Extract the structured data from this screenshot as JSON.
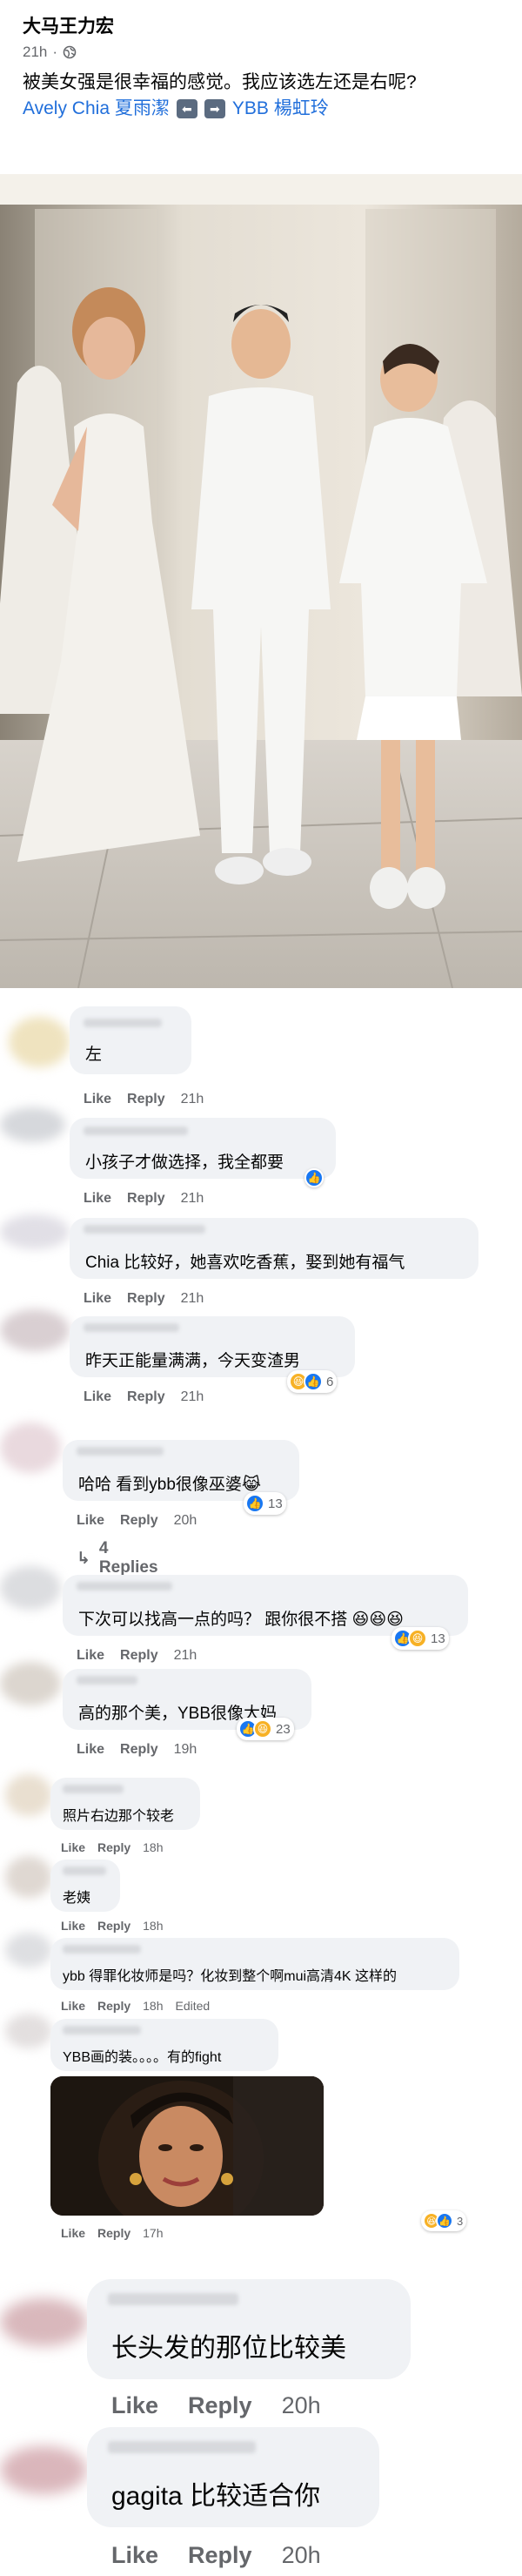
{
  "post": {
    "author": "大马王力宏",
    "time": "21h",
    "separator": "·",
    "text": "被美女强是很幸福的感觉。我应该选左还是右呢?",
    "tag_left": "Avely Chia 夏雨潔",
    "tag_right": "YBB 楊虹玲",
    "arrows": [
      "⬅",
      "➡"
    ]
  },
  "labels": {
    "like": "Like",
    "reply": "Reply"
  },
  "comments": [
    {
      "text": "左",
      "time": "21h"
    },
    {
      "text": "小孩子才做选择，我全都要",
      "time": "21h"
    },
    {
      "text": "Chia 比较好，她喜欢吃香蕉，娶到她有福气",
      "time": "21h"
    },
    {
      "text": "昨天正能量满满，今天变渣男",
      "time": "21h",
      "reactions": "6"
    },
    {
      "text": "哈哈 看到ybb很像巫婆😹",
      "time": "20h",
      "reactions": "13",
      "replies": "4 Replies"
    },
    {
      "text": "下次可以找高一点的吗？ 跟你很不搭 😆😆😆",
      "time": "21h",
      "reactions": "13"
    },
    {
      "text": "高的那个美，YBB很像大妈",
      "time": "19h",
      "reactions": "23"
    },
    {
      "text": "照片右边那个较老",
      "time": "18h"
    },
    {
      "text": "老姨",
      "time": "18h"
    },
    {
      "text": "ybb 得罪化妆师是吗？化妆到整个啊mui高清4K 这样的",
      "time": "18h",
      "edited": "Edited"
    },
    {
      "text": "YBB画的装。。。。有的fight",
      "time": "17h",
      "reactions": "3"
    },
    {
      "text": "长头发的那位比较美",
      "time": "20h"
    },
    {
      "text": "gagita 比较适合你",
      "time": "20h"
    }
  ],
  "colors": {
    "link": "#216fdb",
    "bubble": "#f0f2f5",
    "muted": "#65676b",
    "like_blue": "#1877f2"
  },
  "icons": [
    "globe-icon",
    "like-reaction-icon",
    "haha-reaction-icon",
    "angry-reaction-icon",
    "reply-arrow-icon"
  ]
}
